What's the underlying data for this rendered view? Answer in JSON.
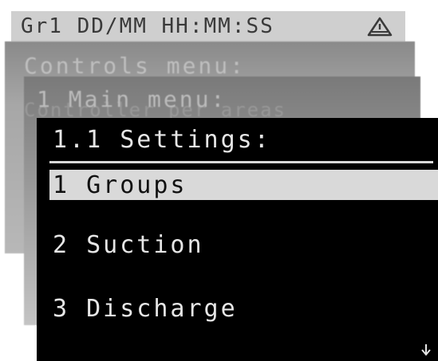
{
  "status_bar": {
    "text": "Gr1 DD/MM HH:MM:SS",
    "icon": "warning-icon"
  },
  "layers": {
    "controls_title": "Controls menu:",
    "main_title": "1 Main menu:",
    "main_ghost_text": "Controller per areas"
  },
  "settings": {
    "title": "1.1 Settings:",
    "items": [
      {
        "label": "1 Groups",
        "selected": true
      },
      {
        "label": "2 Suction",
        "selected": false
      },
      {
        "label": "3 Discharge",
        "selected": false
      }
    ],
    "scroll_icon": "arrow-down-icon"
  },
  "colors": {
    "status_bar_bg": "#cfcfcf",
    "screen_bg": "#000000",
    "text": "#e6e6e6",
    "highlight_bg": "#d9d9d9"
  }
}
